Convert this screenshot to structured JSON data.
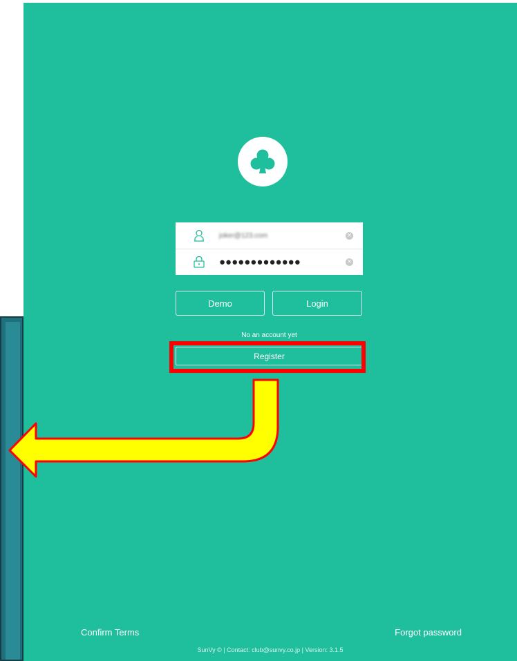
{
  "login": {
    "email_value": "joker@123.com",
    "password_value": "●●●●●●●●●●●●●",
    "clear_glyph": "×"
  },
  "buttons": {
    "demo_label": "Demo",
    "login_label": "Login",
    "register_label": "Register"
  },
  "no_account_text": "No an account yet",
  "footer": {
    "confirm_terms": "Confirm Terms",
    "forgot_password": "Forgot password",
    "version_line": "SunVy © | Contact: club@sunvy.co.jp | Version: 3.1.5"
  },
  "icons": {
    "logo": "club-icon",
    "email": "user-icon",
    "password": "lock-icon"
  },
  "colors": {
    "background": "#1fbf9d",
    "highlight": "#ff0000",
    "arrow_fill": "#ffff00"
  }
}
